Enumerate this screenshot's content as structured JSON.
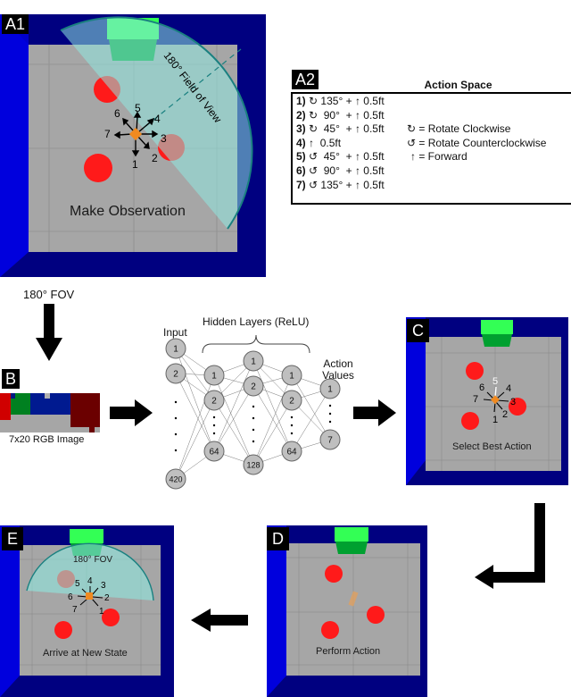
{
  "panels": {
    "A1": {
      "tag": "A1",
      "caption": "Make Observation",
      "fov_label": "180° Field of View",
      "action_numbers": [
        "1",
        "2",
        "3",
        "4",
        "5",
        "6",
        "7"
      ]
    },
    "A2": {
      "tag": "A2",
      "title": "Action Space",
      "actions": [
        {
          "num": "1)",
          "rot": "↻",
          "angle": "135°",
          "plus": "+",
          "fwd": "↑",
          "dist": "0.5ft"
        },
        {
          "num": "2)",
          "rot": "↻",
          "angle": "90°",
          "plus": "+",
          "fwd": "↑",
          "dist": "0.5ft"
        },
        {
          "num": "3)",
          "rot": "↻",
          "angle": "45°",
          "plus": "+",
          "fwd": "↑",
          "dist": "0.5ft"
        },
        {
          "num": "4)",
          "rot": "",
          "angle": "",
          "plus": "",
          "fwd": "↑",
          "dist": "0.5ft"
        },
        {
          "num": "5)",
          "rot": "↺",
          "angle": "45°",
          "plus": "+",
          "fwd": "↑",
          "dist": "0.5ft"
        },
        {
          "num": "6)",
          "rot": "↺",
          "angle": "90°",
          "plus": "+",
          "fwd": "↑",
          "dist": "0.5ft"
        },
        {
          "num": "7)",
          "rot": "↺",
          "angle": "135°",
          "plus": "+",
          "fwd": "↑",
          "dist": "0.5ft"
        }
      ],
      "legend": [
        {
          "symbol": "↻",
          "text": "= Rotate Clockwise"
        },
        {
          "symbol": "↺",
          "text": "= Rotate Counterclockwise"
        },
        {
          "symbol": "↑",
          "text": "= Forward"
        }
      ]
    },
    "B": {
      "tag": "B",
      "arrow_label": "180° FOV",
      "caption": "7x20 RGB Image"
    },
    "network": {
      "input_label": "Input",
      "hidden_label": "Hidden Layers (ReLU)",
      "output_label_1": "Action",
      "output_label_2": "Values",
      "input_nodes": [
        "1",
        "2",
        "420"
      ],
      "hidden1_nodes": [
        "1",
        "2",
        "64"
      ],
      "hidden2_nodes": [
        "1",
        "2",
        "128"
      ],
      "hidden3_nodes": [
        "1",
        "2",
        "64"
      ],
      "output_nodes": [
        "1",
        "7"
      ]
    },
    "C": {
      "tag": "C",
      "caption": "Select Best Action",
      "selected_action": "5",
      "action_numbers": [
        "1",
        "2",
        "3",
        "4",
        "5",
        "6",
        "7"
      ]
    },
    "D": {
      "tag": "D",
      "caption": "Perform Action"
    },
    "E": {
      "tag": "E",
      "caption": "Arrive at New State",
      "fov_label": "180° FOV",
      "action_numbers": [
        "1",
        "2",
        "3",
        "4",
        "5",
        "6",
        "7"
      ]
    }
  },
  "colors": {
    "wall_blue": "#0000cc",
    "wall_dark": "#000080",
    "floor": "#a6a6a6",
    "goal_green": "#00e640",
    "goal_green_dark": "#00a030",
    "ball_red": "#ff1a1a",
    "agent_orange": "#f08a20",
    "fov_teal": "#7fe0d8",
    "fov_edge": "#1a8080",
    "node_fill": "#bfbfbf"
  }
}
